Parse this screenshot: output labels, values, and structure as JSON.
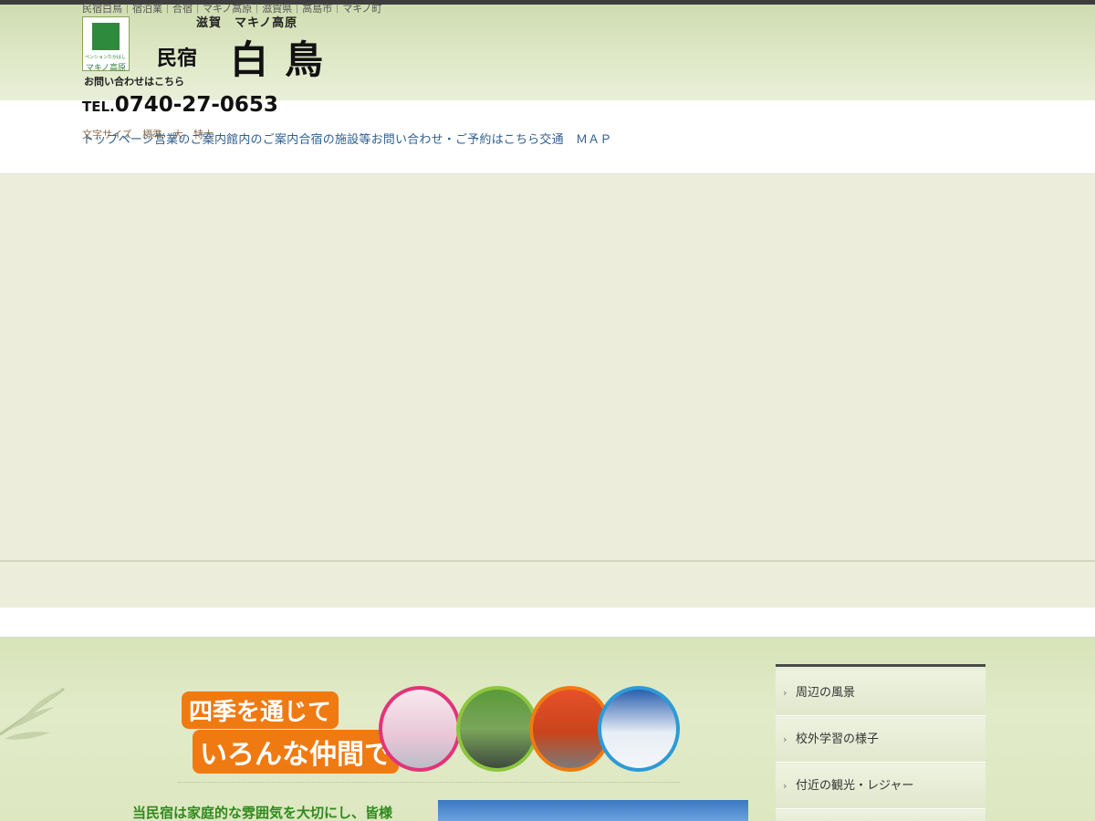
{
  "header": {
    "keywords": "民宿白鳥｜宿泊業｜合宿｜マキノ高原｜滋賀県｜高島市｜マキノ町",
    "logo_sub": "ペンションたかはし 民宿白鳥",
    "logo_name": "マキノ高原",
    "tagline": "滋賀　マキノ高原",
    "title_small": "民宿",
    "title_big": "白鳥",
    "contact_label": "お問い合わせはこちら",
    "tel_prefix": "TEL.",
    "tel_number": "0740-27-0653"
  },
  "fontsize": {
    "label": "文字サイズ",
    "options": [
      "標準",
      "大",
      "特大"
    ]
  },
  "nav": {
    "items": [
      "トップページ",
      "営業のご案内",
      "館内のご案内",
      "合宿の施設等",
      "お問い合わせ・ご予約はこちら",
      "交通　ＭＡＰ"
    ]
  },
  "banner": {
    "line1": "四季を通じて",
    "line2": "いろんな仲間で"
  },
  "content": {
    "intro": "当民宿は家庭的な雰囲気を大切にし、皆様"
  },
  "sidebar": {
    "items": [
      "周辺の風景",
      "校外学習の様子",
      "付近の観光・レジャー"
    ]
  },
  "colors": {
    "nav_link": "#2f5f8f",
    "banner_orange": "#f07a12",
    "intro_green": "#2f8a1d",
    "topbar": "#3d3d3d"
  }
}
